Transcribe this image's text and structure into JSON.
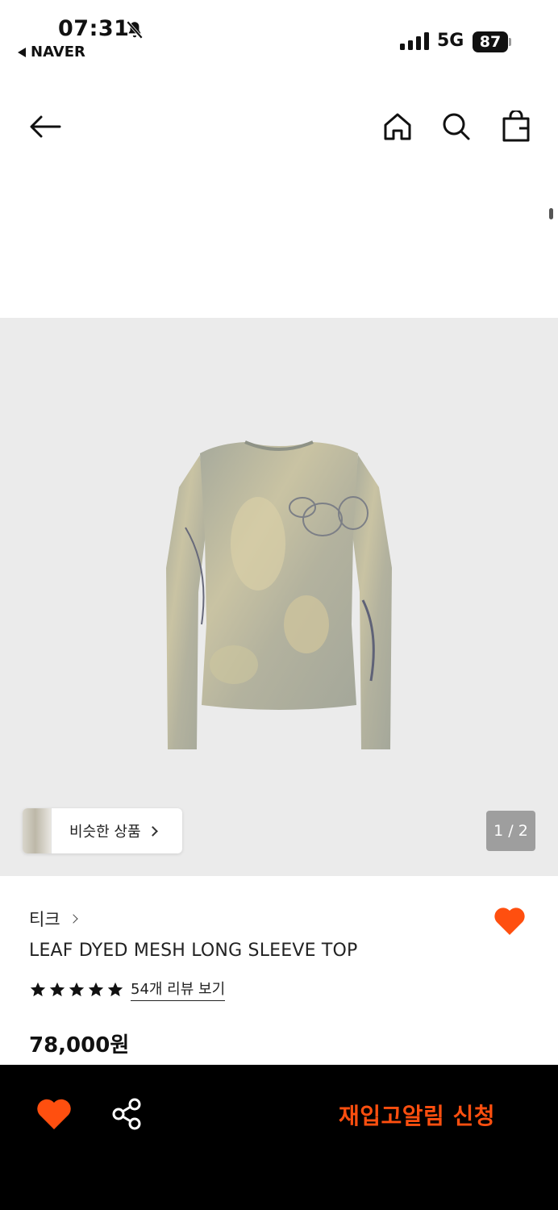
{
  "status_bar": {
    "time": "07:31",
    "back_app": "NAVER",
    "network": "5G",
    "battery": "87"
  },
  "nav": {
    "back_icon": "arrow-left-icon",
    "home_icon": "home-icon",
    "search_icon": "search-icon",
    "bag_icon": "shopping-bag-icon"
  },
  "gallery": {
    "similar_label": "비슷한 상품",
    "page_counter": "1 / 2"
  },
  "product": {
    "brand": "티크",
    "name": "LEAF DYED MESH LONG SLEEVE TOP",
    "rating_stars": 5,
    "review_link": "54개 리뷰 보기",
    "price": "78,000원"
  },
  "bottom_bar": {
    "restock_label": "재입고알림 신청"
  },
  "colors": {
    "accent": "#ff4f0f",
    "bottom_bar_bg": "#000000",
    "gallery_bg": "#ebebeb"
  }
}
